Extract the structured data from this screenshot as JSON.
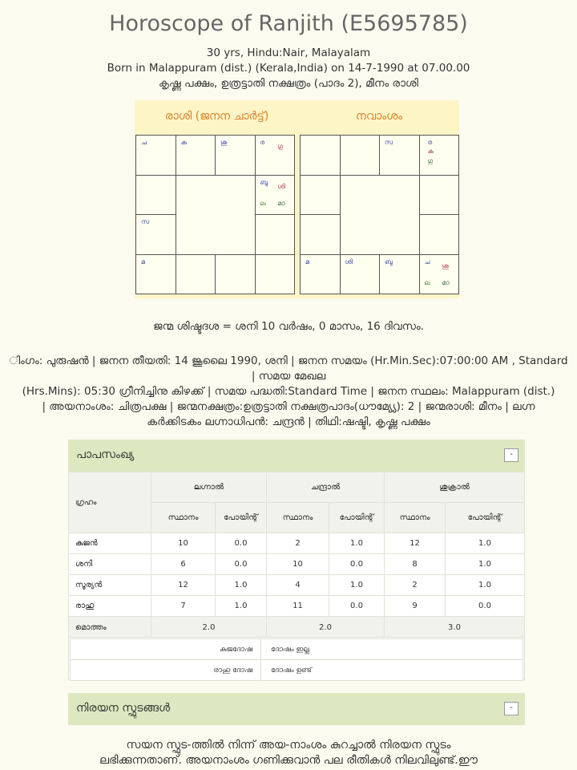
{
  "header": {
    "title": "Horoscope of  Ranjith (E5695785)",
    "line1": "30 yrs, Hindu:Nair, Malayalam",
    "line2": "Born in Malappuram (dist.) (Kerala,India) on 14-7-1990 at 07.00.00",
    "line3": "കൃഷ്ണ പക്ഷം, ഉത്രട്ടാതി നക്ഷത്രം (പാദം 2), മീനം രാശി"
  },
  "charts": {
    "rasi_title": "രാശി (ജനന ചാർട്ട്)",
    "navamsa_title": "നവാംശം",
    "rasi": {
      "c00": [
        "ച"
      ],
      "c01": [
        "കു"
      ],
      "c02": [
        "ശു"
      ],
      "c03": [
        "ര",
        "ഗു"
      ],
      "c13": [
        "ബു",
        "ശി",
        "ല",
        "മാ"
      ],
      "c20": [
        "സ"
      ],
      "c30": [
        "മ"
      ]
    },
    "navamsa": {
      "c02": [
        "സ"
      ],
      "c03": [
        "ര",
        "കു",
        "ഗു"
      ],
      "c30": [
        "മ"
      ],
      "c31": [
        "ശി"
      ],
      "c32": [
        "ബു"
      ],
      "c33": [
        "ച",
        "ശു",
        "ല",
        "മാ"
      ]
    }
  },
  "janma": "ജന്മ ശിഷ്ടദശ = ശനി 10 വർഷം, 0 മാസം, 16 ദിവസം.",
  "details": {
    "l1": "ിംഗം: പുരുഷൻ | ജനന തീയതി: 14 ജൂലൈ 1990, ശനി | ജനന സമയം (Hr.Min.Sec):07:00:00 AM , Standard",
    "l2": "| സമയ മേഖല",
    "l3": "(Hrs.Mins): 05:30 ഗ്രീനിച്ചിനു കിഴക്ക് | സമയ പദ്ധതി:Standard Time | ജനന സ്ഥലം: Malappuram (dist.)",
    "l4": "| അയനാംശം: ചിത്രപക്ഷ | ജന്മനക്ഷത്രം:ഉത്രട്ടാതി നക്ഷത്രപാദം(ധൗമ്യ്യേ): 2 | ജന്മരാശി: മീനം | ലഗ്ന",
    "l5": "കർക്കിടകം ലഗ്നാധിപൻ: ചന്ദ്രൻ | തിഥി:ഷഷ്ടി, കൃഷ്ണ പക്ഷം"
  },
  "papa": {
    "panel_title": "പാപസംഖ്യ",
    "toggle": "-",
    "col_graham": "ഗ്രഹം",
    "groups": [
      "ലഗ്നാൽ",
      "ചന്ദ്രാൽ",
      "ശുക്രാൽ"
    ],
    "sub": [
      "സ്ഥാനം",
      "പോയിന്റ്"
    ],
    "rows": [
      {
        "name": "കുജൻ",
        "v": [
          "10",
          "0.0",
          "2",
          "1.0",
          "12",
          "1.0"
        ]
      },
      {
        "name": "ശനി",
        "v": [
          "6",
          "0.0",
          "10",
          "0.0",
          "8",
          "1.0"
        ]
      },
      {
        "name": "സൂര്യൻ",
        "v": [
          "12",
          "1.0",
          "4",
          "1.0",
          "2",
          "1.0"
        ]
      },
      {
        "name": "രാഹു",
        "v": [
          "7",
          "1.0",
          "11",
          "0.0",
          "9",
          "0.0"
        ]
      }
    ],
    "total_label": "മൊത്തം",
    "totals": [
      "2.0",
      "2.0",
      "3.0"
    ],
    "dosha": [
      {
        "k": "കുജദോഷ",
        "v": "ദോഷം ഇല്ല"
      },
      {
        "k": "രാഹു ദോഷ",
        "v": "ദോഷം ഉണ്ട്"
      }
    ]
  },
  "nirayana": {
    "panel_title": "നിരയന സ്ഫുടങ്ങൾ",
    "toggle": "-",
    "p1": "സയന സ്ഫുട-ത്തിൽ നിന്ന് അയ-നാംശം കുറച്ചാൽ നിരയന സ്ഫുടം",
    "p2": "ലഭിക്കുന്നതാണ്. അയനാംശം ഗണിക്കുവാൻ പല രീതികൾ നിലവിലുണ്ട്.ഈ"
  }
}
